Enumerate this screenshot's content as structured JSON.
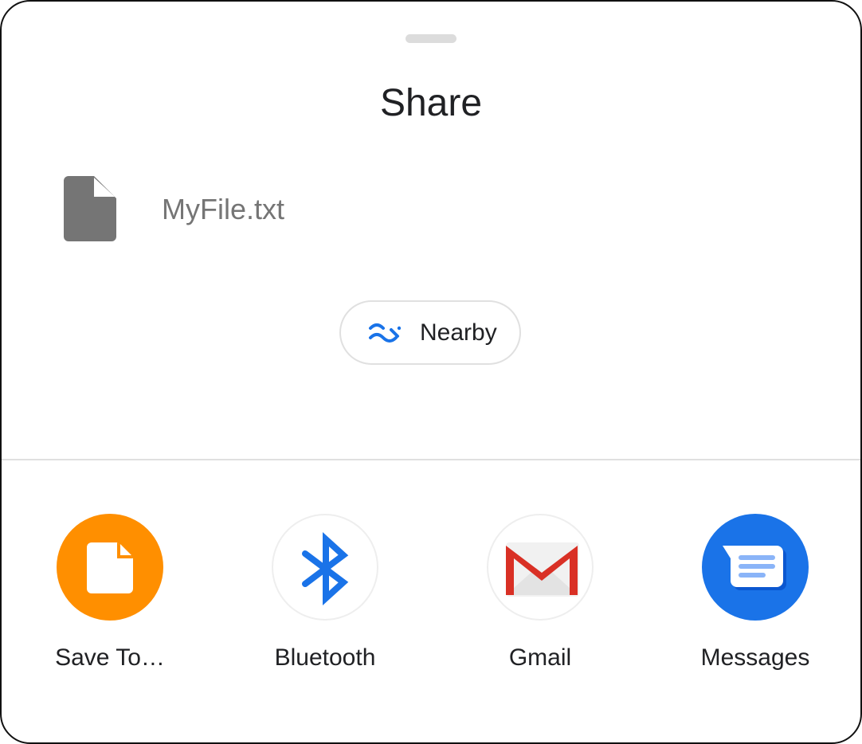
{
  "sheet": {
    "title": "Share",
    "file": {
      "icon": "file-icon",
      "name": "MyFile.txt"
    },
    "nearby": {
      "icon": "nearby-share-icon",
      "label": "Nearby"
    }
  },
  "apps": [
    {
      "label": "Save To…",
      "icon": "save-to-file-icon",
      "color": "#FF8F00"
    },
    {
      "label": "Bluetooth",
      "icon": "bluetooth-icon",
      "color": "#1A73E8"
    },
    {
      "label": "Gmail",
      "icon": "gmail-icon",
      "color": "#DB4437"
    },
    {
      "label": "Messages",
      "icon": "messages-icon",
      "color": "#1A73E8"
    }
  ]
}
